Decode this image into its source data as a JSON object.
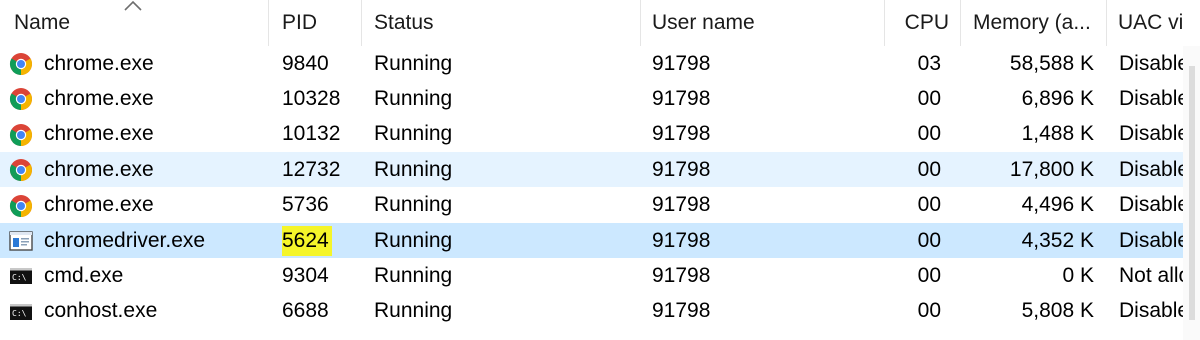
{
  "columns": {
    "name": "Name",
    "pid": "PID",
    "status": "Status",
    "user": "User name",
    "cpu": "CPU",
    "memory": "Memory (a...",
    "uac": "UAC vir"
  },
  "rows": [
    {
      "icon": "chrome-icon",
      "name": "chrome.exe",
      "pid": "9840",
      "status": "Running",
      "user": "91798",
      "cpu": "03",
      "memory": "58,588 K",
      "uac": "Disabled",
      "state": "normal"
    },
    {
      "icon": "chrome-icon",
      "name": "chrome.exe",
      "pid": "10328",
      "status": "Running",
      "user": "91798",
      "cpu": "00",
      "memory": "6,896 K",
      "uac": "Disabled",
      "state": "normal"
    },
    {
      "icon": "chrome-icon",
      "name": "chrome.exe",
      "pid": "10132",
      "status": "Running",
      "user": "91798",
      "cpu": "00",
      "memory": "1,488 K",
      "uac": "Disabled",
      "state": "normal"
    },
    {
      "icon": "chrome-icon",
      "name": "chrome.exe",
      "pid": "12732",
      "status": "Running",
      "user": "91798",
      "cpu": "00",
      "memory": "17,800 K",
      "uac": "Disabled",
      "state": "hover"
    },
    {
      "icon": "chrome-icon",
      "name": "chrome.exe",
      "pid": "5736",
      "status": "Running",
      "user": "91798",
      "cpu": "00",
      "memory": "4,496 K",
      "uac": "Disabled",
      "state": "normal"
    },
    {
      "icon": "app-window-icon",
      "name": "chromedriver.exe",
      "pid": "5624",
      "status": "Running",
      "user": "91798",
      "cpu": "00",
      "memory": "4,352 K",
      "uac": "Disabled",
      "state": "selected",
      "pid_highlight": true
    },
    {
      "icon": "console-icon",
      "name": "cmd.exe",
      "pid": "9304",
      "status": "Running",
      "user": "91798",
      "cpu": "00",
      "memory": "0 K",
      "uac": "Not allo",
      "state": "normal"
    },
    {
      "icon": "console-icon",
      "name": "conhost.exe",
      "pid": "6688",
      "status": "Running",
      "user": "91798",
      "cpu": "00",
      "memory": "5,808 K",
      "uac": "Disabled",
      "state": "normal"
    }
  ],
  "colors": {
    "hover_row": "#e5f3ff",
    "selected_row": "#cce8ff",
    "highlight": "#f5f52a"
  }
}
